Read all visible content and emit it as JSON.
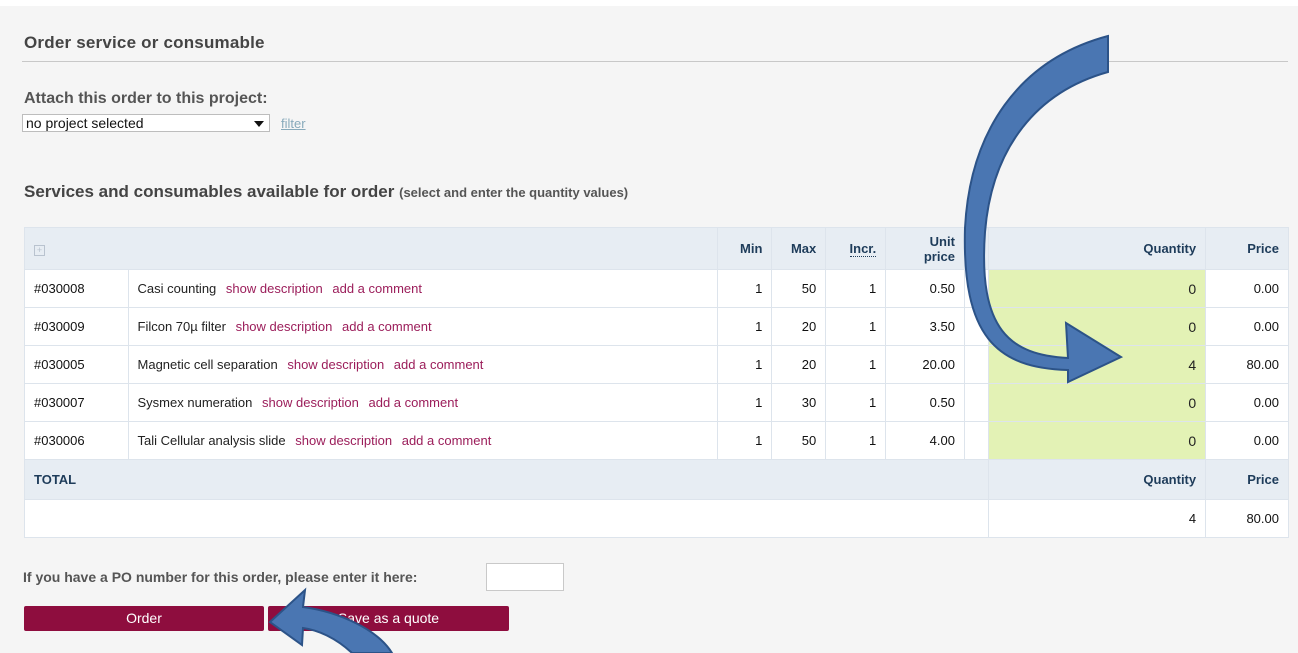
{
  "section": {
    "title": "Order service or consumable"
  },
  "project": {
    "label": "Attach this order to this project:",
    "selected": "no project selected",
    "filter_link": "filter"
  },
  "services": {
    "title": "Services and consumables available for order",
    "hint": "(select and enter the quantity values)"
  },
  "table": {
    "headers": {
      "min": "Min",
      "max": "Max",
      "incr": "Incr.",
      "unit_price": "Unit price",
      "quantity": "Quantity",
      "price": "Price"
    },
    "row_actions": {
      "show_description": "show description",
      "add_comment": "add a comment"
    },
    "rows": [
      {
        "code": "#030008",
        "name": "Casi counting",
        "min": "1",
        "max": "50",
        "incr": "1",
        "unit_price": "0.50",
        "quantity": "0",
        "price": "0.00"
      },
      {
        "code": "#030009",
        "name": "Filcon 70µ filter",
        "min": "1",
        "max": "20",
        "incr": "1",
        "unit_price": "3.50",
        "quantity": "0",
        "price": "0.00"
      },
      {
        "code": "#030005",
        "name": "Magnetic cell separation",
        "min": "1",
        "max": "20",
        "incr": "1",
        "unit_price": "20.00",
        "quantity": "4",
        "price": "80.00"
      },
      {
        "code": "#030007",
        "name": "Sysmex numeration",
        "min": "1",
        "max": "30",
        "incr": "1",
        "unit_price": "0.50",
        "quantity": "0",
        "price": "0.00"
      },
      {
        "code": "#030006",
        "name": "Tali Cellular analysis slide",
        "min": "1",
        "max": "50",
        "incr": "1",
        "unit_price": "4.00",
        "quantity": "0",
        "price": "0.00"
      }
    ],
    "total": {
      "label": "TOTAL",
      "quantity_label": "Quantity",
      "price_label": "Price",
      "quantity": "4",
      "price": "80.00"
    }
  },
  "po": {
    "label": "If you have a PO number for this order, please enter it here:",
    "value": ""
  },
  "buttons": {
    "order": "Order",
    "quote": "Save as a quote"
  },
  "colors": {
    "accent": "#8e0d3e",
    "link": "#9b1d5a",
    "quantity_bg": "#e3f2b5",
    "header_bg": "#e7edf3",
    "arrow": "#4a76b2"
  },
  "icons": {
    "expand": "expand-icon",
    "dropdown": "chevron-down-icon"
  }
}
